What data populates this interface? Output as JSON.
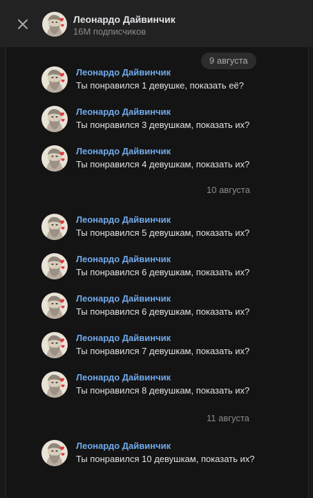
{
  "header": {
    "title": "Леонардо Дайвинчик",
    "subtitle": "16M подписчиков",
    "close_icon": "close-icon"
  },
  "colors": {
    "background": "#191919",
    "header": "#222222",
    "name_link": "#71aaeb",
    "text": "#e1e3e6",
    "muted": "#8a8c8f"
  },
  "dates": [
    {
      "label": "9 августа"
    },
    {
      "label": "10 августа"
    },
    {
      "label": "11 августа"
    }
  ],
  "messages": [
    {
      "name": "Леонардо Дайвинчик",
      "text": "Ты понравился 1 девушке, показать её?"
    },
    {
      "name": "Леонардо Дайвинчик",
      "text": "Ты понравился 3 девушкам, показать их?"
    },
    {
      "name": "Леонардо Дайвинчик",
      "text": "Ты понравился 4 девушкам, показать их?"
    },
    {
      "name": "Леонардо Дайвинчик",
      "text": "Ты понравился 5 девушкам, показать их?"
    },
    {
      "name": "Леонардо Дайвинчик",
      "text": "Ты понравился 6 девушкам, показать их?"
    },
    {
      "name": "Леонардо Дайвинчик",
      "text": "Ты понравился 6 девушкам, показать их?"
    },
    {
      "name": "Леонардо Дайвинчик",
      "text": "Ты понравился 7 девушкам, показать их?"
    },
    {
      "name": "Леонардо Дайвинчик",
      "text": "Ты понравился 8 девушкам, показать их?"
    },
    {
      "name": "Леонардо Дайвинчик",
      "text": "Ты понравился 10 девушкам, показать их?"
    }
  ]
}
